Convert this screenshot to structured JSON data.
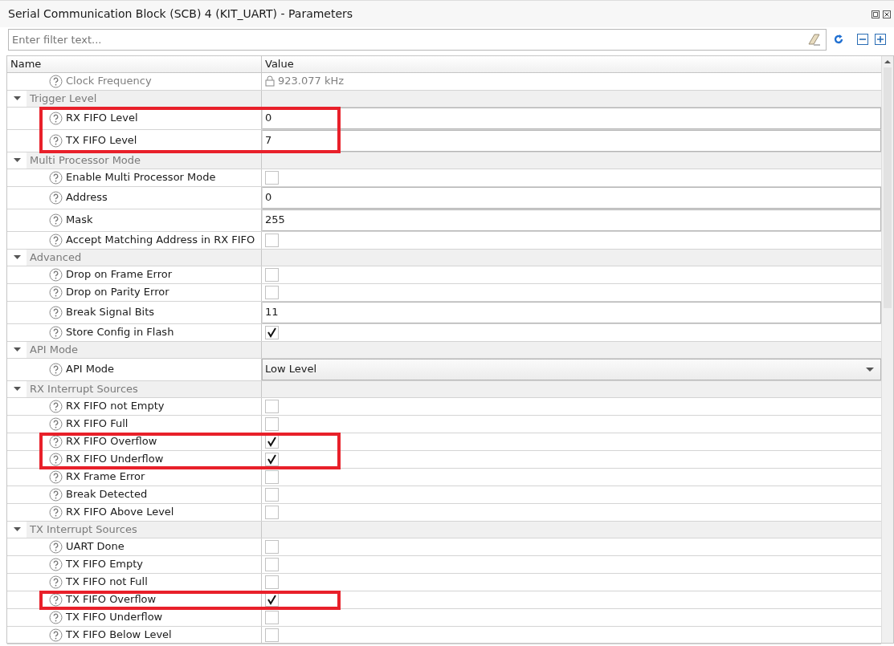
{
  "window": {
    "title": "Serial Communication Block (SCB) 4 (KIT_UART) - Parameters"
  },
  "filter": {
    "placeholder": "Enter filter text..."
  },
  "table": {
    "columns": [
      "Name",
      "Value"
    ],
    "rows": [
      {
        "kind": "readonly",
        "name": "Clock Frequency",
        "value": "923.077 kHz",
        "highlighted": false
      },
      {
        "kind": "group",
        "name": "Trigger Level",
        "expanded": true,
        "children": [
          {
            "kind": "text",
            "name": "RX FIFO Level",
            "value": "0",
            "highlighted": true
          },
          {
            "kind": "text",
            "name": "TX FIFO Level",
            "value": "7",
            "highlighted": true
          }
        ]
      },
      {
        "kind": "group",
        "name": "Multi Processor Mode",
        "expanded": true,
        "children": [
          {
            "kind": "checkbox",
            "name": "Enable Multi Processor Mode",
            "checked": false,
            "highlighted": false
          },
          {
            "kind": "text",
            "name": "Address",
            "value": "0",
            "highlighted": false
          },
          {
            "kind": "text",
            "name": "Mask",
            "value": "255",
            "highlighted": false
          },
          {
            "kind": "checkbox",
            "name": "Accept Matching Address in RX FIFO",
            "checked": false,
            "highlighted": false
          }
        ]
      },
      {
        "kind": "group",
        "name": "Advanced",
        "expanded": true,
        "children": [
          {
            "kind": "checkbox",
            "name": "Drop on Frame Error",
            "checked": false,
            "highlighted": false
          },
          {
            "kind": "checkbox",
            "name": "Drop on Parity Error",
            "checked": false,
            "highlighted": false
          },
          {
            "kind": "text",
            "name": "Break Signal Bits",
            "value": "11",
            "highlighted": false
          },
          {
            "kind": "checkbox",
            "name": "Store Config in Flash",
            "checked": true,
            "highlighted": false
          }
        ]
      },
      {
        "kind": "group",
        "name": "API Mode",
        "expanded": true,
        "children": [
          {
            "kind": "dropdown",
            "name": "API Mode",
            "value": "Low Level",
            "highlighted": false
          }
        ]
      },
      {
        "kind": "group",
        "name": "RX Interrupt Sources",
        "expanded": true,
        "children": [
          {
            "kind": "checkbox",
            "name": "RX FIFO not Empty",
            "checked": false,
            "highlighted": false
          },
          {
            "kind": "checkbox",
            "name": "RX FIFO Full",
            "checked": false,
            "highlighted": false
          },
          {
            "kind": "checkbox",
            "name": "RX FIFO Overflow",
            "checked": true,
            "highlighted": true
          },
          {
            "kind": "checkbox",
            "name": "RX FIFO Underflow",
            "checked": true,
            "highlighted": true
          },
          {
            "kind": "checkbox",
            "name": "RX Frame Error",
            "checked": false,
            "highlighted": false
          },
          {
            "kind": "checkbox",
            "name": "Break Detected",
            "checked": false,
            "highlighted": false
          },
          {
            "kind": "checkbox",
            "name": "RX FIFO Above Level",
            "checked": false,
            "highlighted": false
          }
        ]
      },
      {
        "kind": "group",
        "name": "TX Interrupt Sources",
        "expanded": true,
        "children": [
          {
            "kind": "checkbox",
            "name": "UART Done",
            "checked": false,
            "highlighted": false
          },
          {
            "kind": "checkbox",
            "name": "TX FIFO Empty",
            "checked": false,
            "highlighted": false
          },
          {
            "kind": "checkbox",
            "name": "TX FIFO not Full",
            "checked": false,
            "highlighted": false
          },
          {
            "kind": "checkbox",
            "name": "TX FIFO Overflow",
            "checked": true,
            "highlighted": true
          },
          {
            "kind": "checkbox",
            "name": "TX FIFO Underflow",
            "checked": false,
            "highlighted": false
          },
          {
            "kind": "checkbox",
            "name": "TX FIFO Below Level",
            "checked": false,
            "highlighted": false
          }
        ]
      }
    ]
  }
}
